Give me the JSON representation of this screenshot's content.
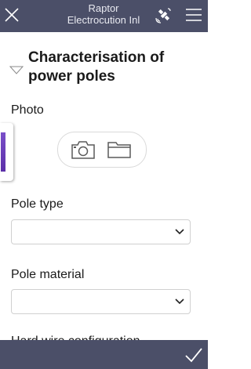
{
  "header": {
    "title_line1": "Raptor",
    "title_line2": "Electrocution Inl"
  },
  "section": {
    "title": "Characterisation of power poles"
  },
  "photo": {
    "label": "Photo"
  },
  "pole_type": {
    "label": "Pole type",
    "value": ""
  },
  "pole_material": {
    "label": "Pole material",
    "value": ""
  },
  "next_field": {
    "label": "Hard wire configuration"
  },
  "colors": {
    "bar": "#4b4f68",
    "accent": "#6a3fbd"
  },
  "icons": {
    "close": "close-icon",
    "satellite": "satellite-icon",
    "menu": "menu-icon",
    "camera": "camera-icon",
    "folder": "folder-icon",
    "check": "check-icon"
  }
}
